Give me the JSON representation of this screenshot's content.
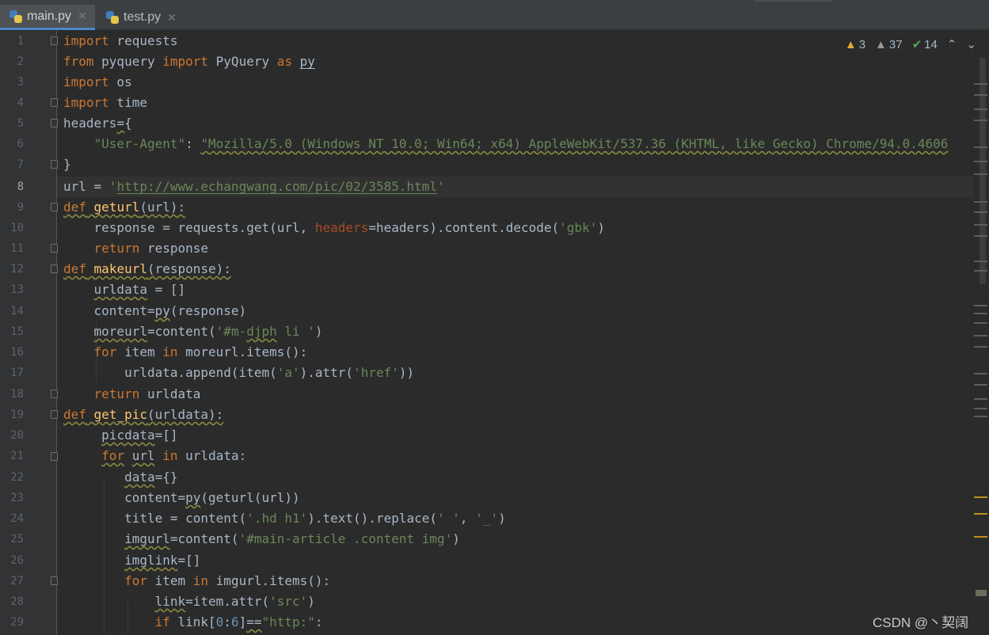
{
  "tabs": [
    {
      "label": "main.py",
      "active": true,
      "icon": "python-file-icon"
    },
    {
      "label": "test.py",
      "active": false,
      "icon": "python-file-icon"
    }
  ],
  "inspection": {
    "warnings": "3",
    "weak_warnings": "37",
    "typos": "14"
  },
  "line_numbers": [
    "1",
    "2",
    "3",
    "4",
    "5",
    "6",
    "7",
    "8",
    "9",
    "10",
    "11",
    "12",
    "13",
    "14",
    "15",
    "16",
    "17",
    "18",
    "19",
    "20",
    "21",
    "22",
    "23",
    "24",
    "25",
    "26",
    "27",
    "28",
    "29"
  ],
  "code": {
    "l1": [
      "import",
      " requests"
    ],
    "l2": [
      "from",
      " pyquery ",
      "import",
      " PyQuery ",
      "as",
      " ",
      "py"
    ],
    "l3": [
      "import",
      " os"
    ],
    "l4": [
      "import",
      " time"
    ],
    "l5": [
      "headers",
      "=",
      "{"
    ],
    "l6": [
      "    ",
      "\"User-Agent\"",
      ": ",
      "\"Mozilla/5.0 (Windows NT 10.0; Win64; x64) AppleWebKit/537.36 (KHTML, like Gecko) Chrome/94.0.4606"
    ],
    "l7": [
      "}"
    ],
    "l8": [
      "url = ",
      "'",
      "http://www.echangwang.com/pic/02/3585.html",
      "'"
    ],
    "l9": [
      "def",
      " ",
      "geturl",
      "(url):"
    ],
    "l10": [
      "    response = requests.get(url, ",
      "headers",
      "=headers).content.decode(",
      "'gbk'",
      ")"
    ],
    "l11": [
      "    ",
      "return",
      " response"
    ],
    "l12": [
      "def",
      " ",
      "makeurl",
      "(response):"
    ],
    "l13": [
      "    ",
      "urldata",
      " = []"
    ],
    "l14": [
      "    content=",
      "py",
      "(response)"
    ],
    "l15": [
      "    ",
      "moreurl",
      "=content(",
      "'#m-",
      "djph",
      " li '",
      ")"
    ],
    "l16": [
      "    ",
      "for",
      " item ",
      "in",
      " moreurl.items():"
    ],
    "l17": [
      "        urldata.append(item(",
      "'a'",
      ").attr(",
      "'href'",
      "))"
    ],
    "l18": [
      "    ",
      "return",
      " urldata"
    ],
    "l19": [
      "def",
      " ",
      "get_pic",
      "(urldata):"
    ],
    "l20": [
      "     ",
      "picdata",
      "=[]"
    ],
    "l21": [
      "     ",
      "for",
      " ",
      "url",
      " ",
      "in",
      " urldata:"
    ],
    "l22": [
      "        ",
      "data",
      "={}"
    ],
    "l23": [
      "        content=",
      "py",
      "(geturl(url))"
    ],
    "l24": [
      "        title = content(",
      "'.hd h1'",
      ").text().replace(",
      "' '",
      ", ",
      "'_'",
      ")"
    ],
    "l25": [
      "        ",
      "imgurl",
      "=content(",
      "'#main-article .content img'",
      ")"
    ],
    "l26": [
      "        ",
      "imglink",
      "=[]"
    ],
    "l27": [
      "        ",
      "for",
      " item ",
      "in",
      " imgurl.items():"
    ],
    "l28": [
      "            ",
      "link",
      "=item.attr(",
      "'src'",
      ")"
    ],
    "l29": [
      "            ",
      "if",
      " link[",
      "0",
      ":",
      "6",
      "]",
      "==",
      "\"http:\"",
      ":"
    ]
  },
  "watermark": "CSDN @丶契阔",
  "colors": {
    "keyword": "#cc7832",
    "function": "#ffc66d",
    "string": "#6a8759",
    "param": "#aa4926",
    "number": "#6897bb",
    "text": "#a9b7c6",
    "background": "#2b2b2b"
  }
}
